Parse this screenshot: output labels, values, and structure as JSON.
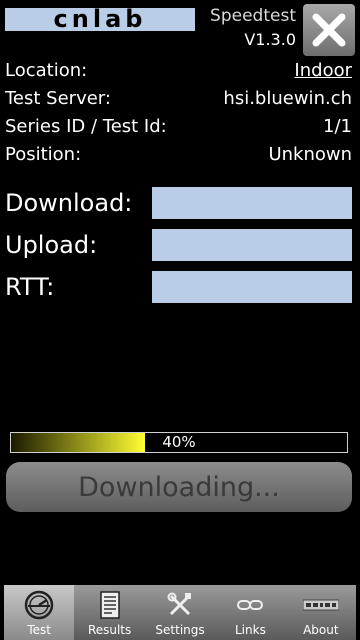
{
  "header": {
    "logo_text": "cnlab",
    "app_title": "Speedtest",
    "version": "V1.3.0",
    "close_icon": "close-x-icon"
  },
  "info": {
    "location_label": "Location:",
    "location_value": "Indoor",
    "server_label": "Test Server:",
    "server_value": "hsi.bluewin.ch",
    "series_label": "Series ID / Test Id:",
    "series_value": "1/1",
    "position_label": "Position:",
    "position_value": "Unknown"
  },
  "metrics": {
    "download_label": "Download:",
    "upload_label": "Upload:",
    "rtt_label": "RTT:"
  },
  "progress": {
    "percent": 40,
    "text": "40%"
  },
  "action_button": {
    "label": "Downloading..."
  },
  "tabs": [
    {
      "label": "Test",
      "icon": "speedometer-icon",
      "active": true
    },
    {
      "label": "Results",
      "icon": "document-icon",
      "active": false
    },
    {
      "label": "Settings",
      "icon": "tools-icon",
      "active": false
    },
    {
      "label": "Links",
      "icon": "chain-link-icon",
      "active": false
    },
    {
      "label": "About",
      "icon": "cnlab-logo-icon",
      "active": false
    }
  ],
  "colors": {
    "field_bg": "#b9cde6",
    "progress_fill": "#ffff33",
    "background": "#000000"
  }
}
